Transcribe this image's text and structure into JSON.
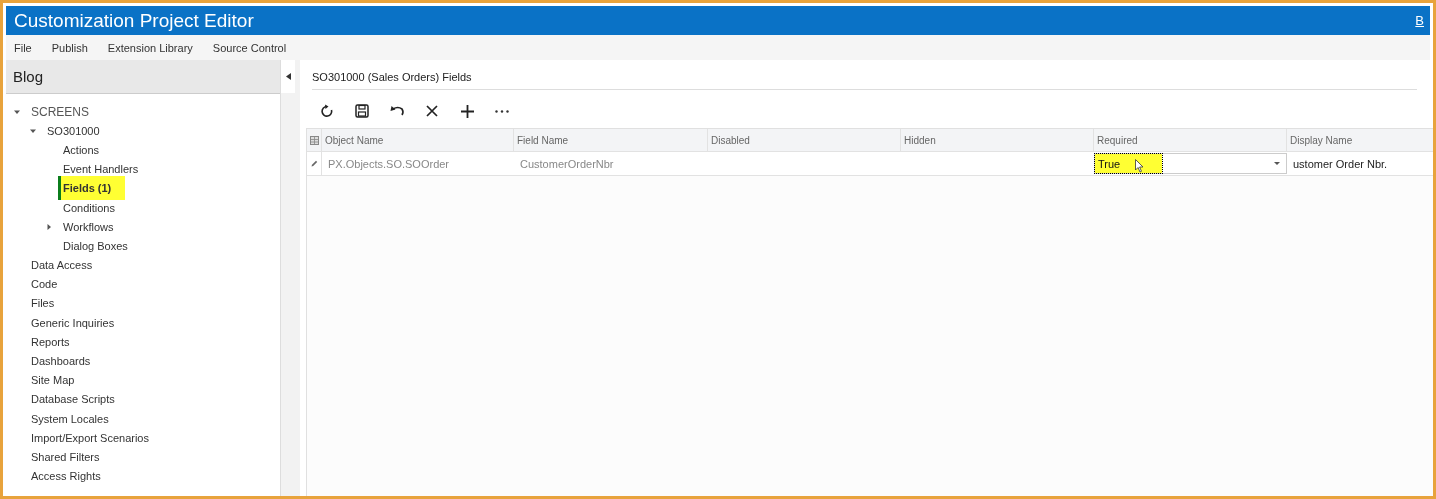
{
  "window": {
    "title": "Customization Project Editor",
    "corner_link": "B"
  },
  "menu": [
    "File",
    "Publish",
    "Extension Library",
    "Source Control"
  ],
  "sidebar": {
    "title": "Blog",
    "items": [
      {
        "label": "SCREENS",
        "kind": "section",
        "expanded": true,
        "selected": false,
        "highlighted": false,
        "children": [
          {
            "label": "SO301000",
            "kind": "node",
            "expanded": true,
            "selected": false,
            "highlighted": false,
            "children": [
              {
                "label": "Actions",
                "kind": "node",
                "selected": false,
                "highlighted": false
              },
              {
                "label": "Event Handlers",
                "kind": "node",
                "selected": false,
                "highlighted": false
              },
              {
                "label": "Fields (1)",
                "kind": "node",
                "selected": true,
                "highlighted": true
              },
              {
                "label": "Conditions",
                "kind": "node",
                "selected": false,
                "highlighted": false
              },
              {
                "label": "Workflows",
                "kind": "node",
                "expanded": false,
                "selected": false,
                "highlighted": false
              },
              {
                "label": "Dialog Boxes",
                "kind": "node",
                "selected": false,
                "highlighted": false
              }
            ]
          }
        ]
      },
      {
        "label": "Data Access",
        "kind": "node",
        "selected": false,
        "highlighted": false
      },
      {
        "label": "Code",
        "kind": "node",
        "selected": false,
        "highlighted": false
      },
      {
        "label": "Files",
        "kind": "node",
        "selected": false,
        "highlighted": false
      },
      {
        "label": "Generic Inquiries",
        "kind": "node",
        "selected": false,
        "highlighted": false
      },
      {
        "label": "Reports",
        "kind": "node",
        "selected": false,
        "highlighted": false
      },
      {
        "label": "Dashboards",
        "kind": "node",
        "selected": false,
        "highlighted": false
      },
      {
        "label": "Site Map",
        "kind": "node",
        "selected": false,
        "highlighted": false
      },
      {
        "label": "Database Scripts",
        "kind": "node",
        "selected": false,
        "highlighted": false
      },
      {
        "label": "System Locales",
        "kind": "node",
        "selected": false,
        "highlighted": false
      },
      {
        "label": "Import/Export Scenarios",
        "kind": "node",
        "selected": false,
        "highlighted": false
      },
      {
        "label": "Shared Filters",
        "kind": "node",
        "selected": false,
        "highlighted": false
      },
      {
        "label": "Access Rights",
        "kind": "node",
        "selected": false,
        "highlighted": false
      }
    ]
  },
  "content": {
    "title": "SO301000 (Sales Orders) Fields",
    "toolbar": [
      {
        "kind": "refresh"
      },
      {
        "kind": "save"
      },
      {
        "kind": "undo"
      },
      {
        "kind": "delete"
      },
      {
        "kind": "add"
      },
      {
        "kind": "more"
      }
    ],
    "table": {
      "columns": [
        "Object Name",
        "Field Name",
        "Disabled",
        "Hidden",
        "Required",
        "Display Name"
      ],
      "rows": [
        {
          "cells": [
            {
              "kind": "text",
              "text": "PX.Objects.SO.SOOrder",
              "muted": true
            },
            {
              "kind": "text",
              "text": "CustomerOrderNbr",
              "muted": true
            },
            {
              "kind": "empty"
            },
            {
              "kind": "empty"
            },
            {
              "kind": "dropdown",
              "text": "True",
              "highlighted": true
            },
            {
              "kind": "text",
              "text": "ustomer Order Nbr.",
              "muted": false
            }
          ]
        }
      ]
    }
  }
}
